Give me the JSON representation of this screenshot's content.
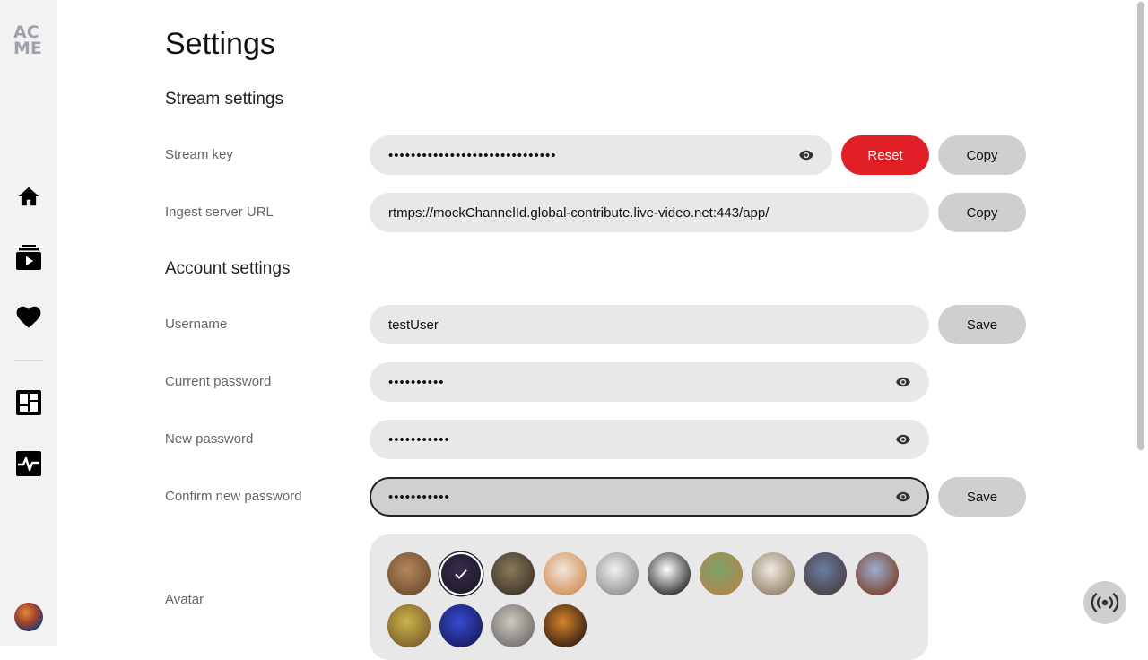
{
  "app": {
    "logo_text": "AC ME"
  },
  "sidebar": {
    "items": [
      {
        "name": "home",
        "icon": "home-icon"
      },
      {
        "name": "videos",
        "icon": "video-library-icon"
      },
      {
        "name": "favorites",
        "icon": "heart-icon"
      },
      {
        "name": "dashboard",
        "icon": "dashboard-icon"
      },
      {
        "name": "activity",
        "icon": "activity-icon"
      }
    ],
    "avatar_icon": "user-avatar"
  },
  "page": {
    "title": "Settings"
  },
  "stream_settings": {
    "section_title": "Stream settings",
    "stream_key": {
      "label": "Stream key",
      "value": "••••••••••••••••••••••••••••••",
      "reset_label": "Reset",
      "copy_label": "Copy"
    },
    "ingest_url": {
      "label": "Ingest server URL",
      "value": "rtmps://mockChannelId.global-contribute.live-video.net:443/app/",
      "copy_label": "Copy"
    }
  },
  "account_settings": {
    "section_title": "Account settings",
    "username": {
      "label": "Username",
      "value": "testUser",
      "save_label": "Save"
    },
    "current_password": {
      "label": "Current password",
      "value": "••••••••••"
    },
    "new_password": {
      "label": "New password",
      "value": "•••••••••••"
    },
    "confirm_password": {
      "label": "Confirm new password",
      "value": "•••••••••••",
      "save_label": "Save"
    },
    "avatar": {
      "label": "Avatar",
      "options": [
        {
          "name": "bear",
          "colors": [
            "#b5875a",
            "#6b4a2c"
          ]
        },
        {
          "name": "bird",
          "colors": [
            "#3a2a4a",
            "#1b1a2a"
          ],
          "selected": true
        },
        {
          "name": "owl",
          "colors": [
            "#8a7a5a",
            "#3a3226"
          ]
        },
        {
          "name": "dog-shiba",
          "colors": [
            "#f3e6da",
            "#cf8a4f"
          ]
        },
        {
          "name": "dog-pitbull",
          "colors": [
            "#f2f2f2",
            "#8a8a8a"
          ]
        },
        {
          "name": "pug",
          "colors": [
            "#ffffff",
            "#1e1e1e"
          ]
        },
        {
          "name": "giraffe",
          "colors": [
            "#7aa36a",
            "#b4844a"
          ]
        },
        {
          "name": "hedgehog",
          "colors": [
            "#f0ece4",
            "#8d7a60"
          ]
        },
        {
          "name": "hippo",
          "colors": [
            "#6a7ea0",
            "#4a3a40"
          ]
        },
        {
          "name": "horse",
          "colors": [
            "#9bb0d0",
            "#7a3a22"
          ]
        },
        {
          "name": "gazelle",
          "colors": [
            "#c9b34a",
            "#7a5a2a"
          ]
        },
        {
          "name": "jellyfish",
          "colors": [
            "#3a4ad0",
            "#131a5a"
          ]
        },
        {
          "name": "sheep",
          "colors": [
            "#cfc8bc",
            "#6a6a6a"
          ]
        },
        {
          "name": "tiger",
          "colors": [
            "#d8822a",
            "#2a1a10"
          ]
        }
      ]
    }
  },
  "floating": {
    "broadcast_icon": "broadcast-icon"
  },
  "colors": {
    "accent_red": "#e02026",
    "field_bg": "#e8e8e8",
    "button_gray": "#cfcfcf"
  }
}
